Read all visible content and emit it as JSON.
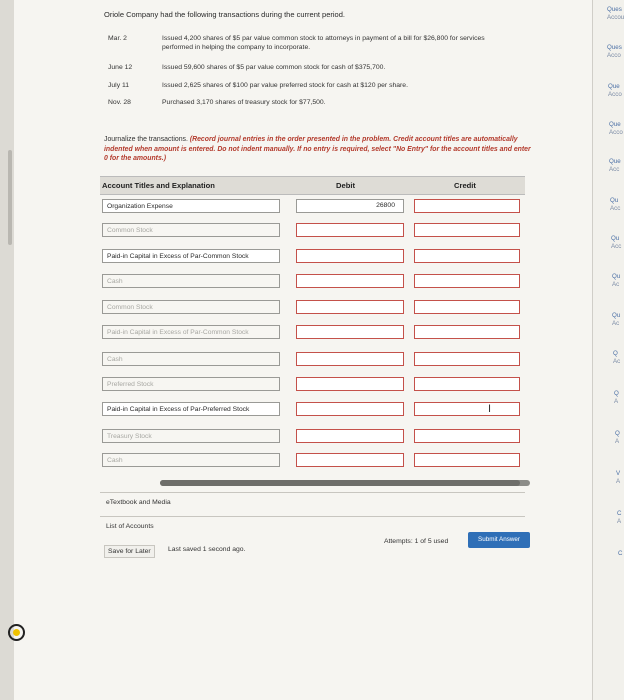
{
  "problem": {
    "title": "Oriole Company had the following transactions during the current period.",
    "transactions": [
      {
        "date": "Mar.    2",
        "text": "Issued 4,200 shares of $5 par value common stock to attorneys in payment of a bill for $26,800 for services performed in helping the company to incorporate."
      },
      {
        "date": "June   12",
        "text": "Issued 59,600 shares of $5 par value common stock for cash of $375,700."
      },
      {
        "date": "July    11",
        "text": "Issued 2,625 shares of $100 par value preferred stock for cash at $120 per share."
      },
      {
        "date": "Nov.   28",
        "text": "Purchased 3,170 shares of treasury stock for $77,500."
      }
    ],
    "instruction_lead": "Journalize the transactions.",
    "instruction_note": "(Record journal entries in the order presented in the problem. Credit account titles are automatically indented when amount is entered. Do not indent manually. If no entry is required, select \"No Entry\" for the account titles and enter 0 for the amounts.)"
  },
  "table": {
    "col_account": "Account Titles and Explanation",
    "col_debit": "Debit",
    "col_credit": "Credit",
    "rows": [
      {
        "account": "Organization Expense",
        "debit": "26800",
        "credit": ""
      },
      {
        "account": "Common Stock",
        "debit": "",
        "credit": ""
      },
      {
        "account": "Paid-in Capital in Excess of Par-Common Stock",
        "debit": "",
        "credit": ""
      },
      {
        "account": "Cash",
        "debit": "",
        "credit": ""
      },
      {
        "account": "Common Stock",
        "debit": "",
        "credit": ""
      },
      {
        "account": "Paid-in Capital in Excess of Par-Common Stock",
        "debit": "",
        "credit": ""
      },
      {
        "account": "Cash",
        "debit": "",
        "credit": ""
      },
      {
        "account": "Preferred Stock",
        "debit": "",
        "credit": ""
      },
      {
        "account": "Paid-in Capital in Excess of Par-Preferred Stock",
        "debit": "",
        "credit": ""
      },
      {
        "account": "Treasury Stock",
        "debit": "",
        "credit": ""
      },
      {
        "account": "Cash",
        "debit": "",
        "credit": ""
      }
    ]
  },
  "links": {
    "etextbook": "eTextbook and Media",
    "list_accounts": "List of Accounts"
  },
  "footer": {
    "save_later": "Save for Later",
    "last_saved": "Last saved 1 second ago.",
    "attempts": "Attempts: 1 of 5 used",
    "submit": "Submit Answer"
  },
  "side_panel": {
    "items": [
      {
        "label": "Ques",
        "sub": "Accou"
      },
      {
        "label": "Ques",
        "sub": "Acco"
      },
      {
        "label": "Que",
        "sub": "Acco"
      },
      {
        "label": "Que",
        "sub": "Acco"
      },
      {
        "label": "Que",
        "sub": "Acc"
      },
      {
        "label": "Qu",
        "sub": "Acc"
      },
      {
        "label": "Qu",
        "sub": "Acc"
      },
      {
        "label": "Qu",
        "sub": "Ac"
      },
      {
        "label": "Qu",
        "sub": "Ac"
      },
      {
        "label": "Q",
        "sub": "Ac"
      },
      {
        "label": "Q",
        "sub": "A"
      },
      {
        "label": "Q",
        "sub": "A"
      },
      {
        "label": "V",
        "sub": "A"
      },
      {
        "label": "C",
        "sub": "A"
      },
      {
        "label": "C",
        "sub": ""
      }
    ]
  }
}
